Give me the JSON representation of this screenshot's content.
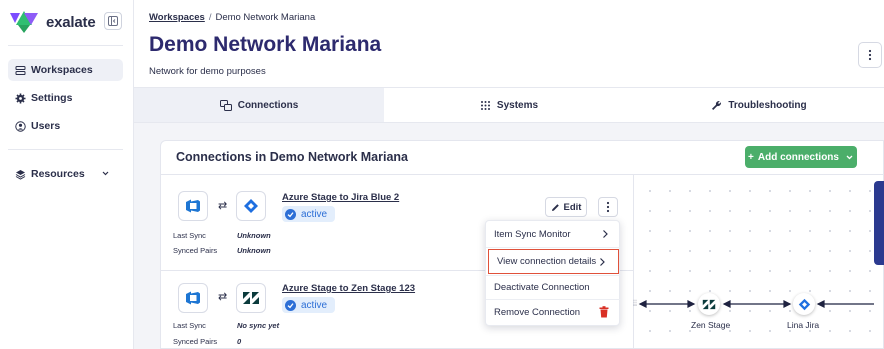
{
  "sidebar": {
    "brand": "exalate",
    "items": [
      {
        "label": "Workspaces",
        "icon": "workspaces-icon",
        "active": true
      },
      {
        "label": "Settings",
        "icon": "gear-icon",
        "active": false
      },
      {
        "label": "Users",
        "icon": "user-icon",
        "active": false
      }
    ],
    "resources_label": "Resources"
  },
  "header": {
    "breadcrumb_root": "Workspaces",
    "breadcrumb_sep": "/",
    "breadcrumb_current": "Demo Network Mariana",
    "title": "Demo Network Mariana",
    "subtitle": "Network for demo purposes"
  },
  "tabs": [
    {
      "label": "Connections",
      "icon": "connections-icon",
      "active": true
    },
    {
      "label": "Systems",
      "icon": "grid-icon",
      "active": false
    },
    {
      "label": "Troubleshooting",
      "icon": "wrench-icon",
      "active": false
    }
  ],
  "panel": {
    "title": "Connections in Demo Network Mariana",
    "add_label": "Add connections",
    "add_color": "#4bae6a"
  },
  "connections": [
    {
      "name": "Azure Stage to Jira Blue 2",
      "status": "active",
      "last_sync_label": "Last Sync",
      "last_sync": "Unknown",
      "synced_pairs_label": "Synced Pairs",
      "synced_pairs": "Unknown",
      "edit_label": "Edit"
    },
    {
      "name": "Azure Stage to Zen Stage 123",
      "status": "active",
      "last_sync_label": "Last Sync",
      "last_sync": "No sync yet",
      "synced_pairs_label": "Synced Pairs",
      "synced_pairs": "0"
    }
  ],
  "menu": {
    "items": [
      {
        "label": "Item Sync Monitor"
      },
      {
        "label": "View connection details",
        "highlighted": true
      },
      {
        "label": "Deactivate Connection"
      },
      {
        "label": "Remove Connection",
        "icon": "trash-icon",
        "icon_color": "#d93025"
      }
    ]
  },
  "graph": {
    "nodes": [
      {
        "label": "Zen Stage",
        "icon": "zendesk-icon"
      },
      {
        "label": "Lina Jira",
        "icon": "jira-icon"
      }
    ]
  }
}
